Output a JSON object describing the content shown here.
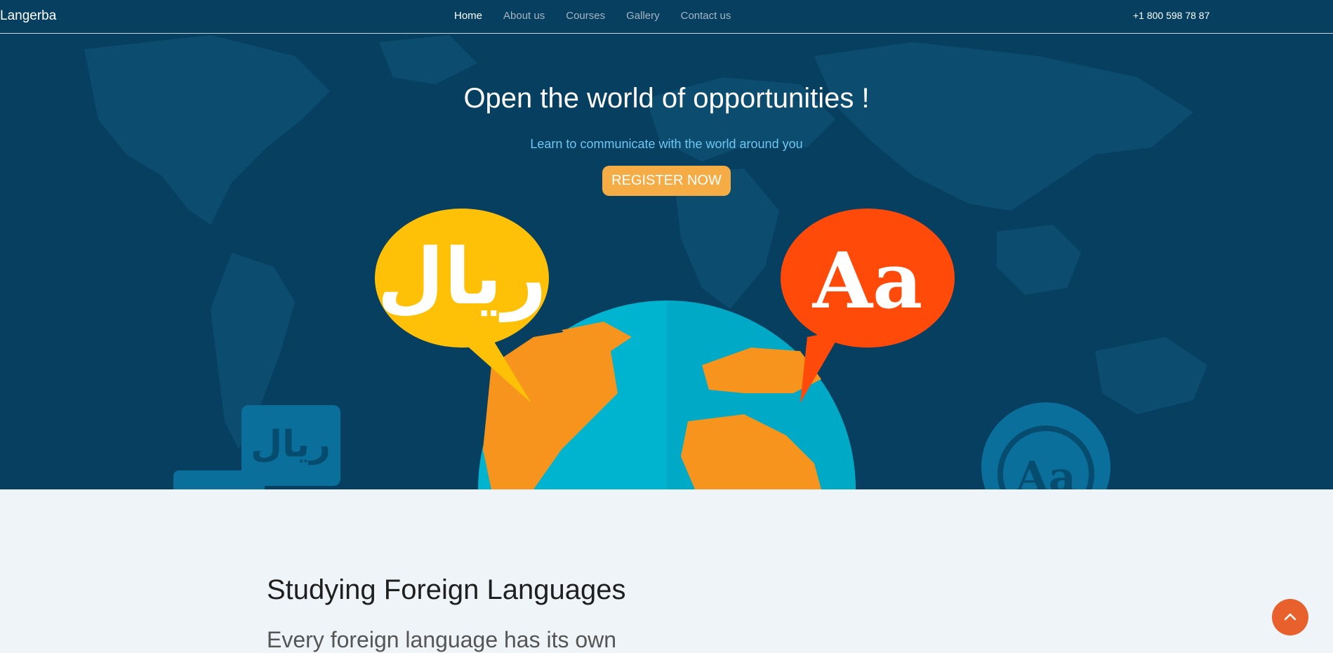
{
  "nav": {
    "brand": "Langerba",
    "links": [
      {
        "label": "Home"
      },
      {
        "label": "About us"
      },
      {
        "label": "Courses"
      },
      {
        "label": "Gallery"
      },
      {
        "label": "Contact us"
      }
    ],
    "phone": "+1 800 598 78 87"
  },
  "hero": {
    "title": "Open the world of opportunities !",
    "subtitle": "Learn to communicate with the world around you",
    "cta_label": "REGISTER NOW",
    "bubble_left_text": "ريال",
    "bubble_right_text": "Aa",
    "small_left_text": "ريال",
    "small_right_text": "Aa"
  },
  "section": {
    "title": "Studying Foreign Languages",
    "text": "Every foreign language has its own"
  },
  "colors": {
    "hero_bg": "#063f60",
    "cta": "#f5ac45",
    "scroll_top": "#e8612c",
    "bubble_yellow": "#ffc107",
    "bubble_red": "#ff4a0a",
    "globe_ocean": "#00b4d0",
    "globe_land": "#f7941d"
  },
  "icons": {
    "scroll_top": "chevron-up-icon"
  }
}
